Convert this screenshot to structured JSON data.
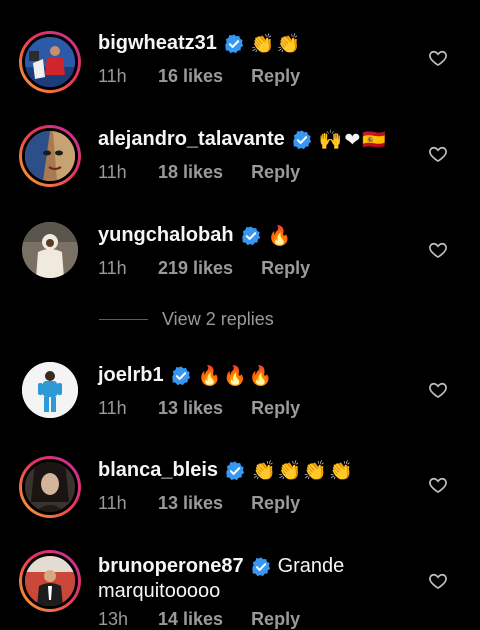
{
  "comments": [
    {
      "username": "bigwheatz31",
      "verified": true,
      "emoji": "👏👏",
      "text": "",
      "time": "11h",
      "likes": "16 likes",
      "reply": "Reply",
      "avatar": "soccer-player-red-jersey"
    },
    {
      "username": "alejandro_talavante",
      "verified": true,
      "emoji": "🙌❤🇪🇸",
      "text": "",
      "time": "11h",
      "likes": "18 likes",
      "reply": "Reply",
      "avatar": "painted-face"
    },
    {
      "username": "yungchalobah",
      "verified": true,
      "emoji": "🔥",
      "text": "",
      "time": "11h",
      "likes": "219 likes",
      "reply": "Reply",
      "avatar": "person-white-hoodie"
    },
    {
      "username": "joelrb1",
      "verified": true,
      "emoji": "🔥🔥🔥",
      "text": "",
      "time": "11h",
      "likes": "13 likes",
      "reply": "Reply",
      "avatar": "goalkeeper-blue-kit"
    },
    {
      "username": "blanca_bleis",
      "verified": true,
      "emoji": "👏👏👏👏",
      "text": "",
      "time": "11h",
      "likes": "13 likes",
      "reply": "Reply",
      "avatar": "woman-portrait"
    },
    {
      "username": "brunoperone87",
      "verified": true,
      "emoji": "",
      "text": "Grande",
      "text2": "marquitooooo",
      "time": "13h",
      "likes": "14 likes",
      "reply": "Reply",
      "avatar": "man-suit-stadium"
    }
  ],
  "view_replies": "View 2 replies",
  "colors": {
    "background": "#000000",
    "text": "#f5f5f5",
    "meta": "#9a9a9a",
    "verified": "#3897f0"
  }
}
